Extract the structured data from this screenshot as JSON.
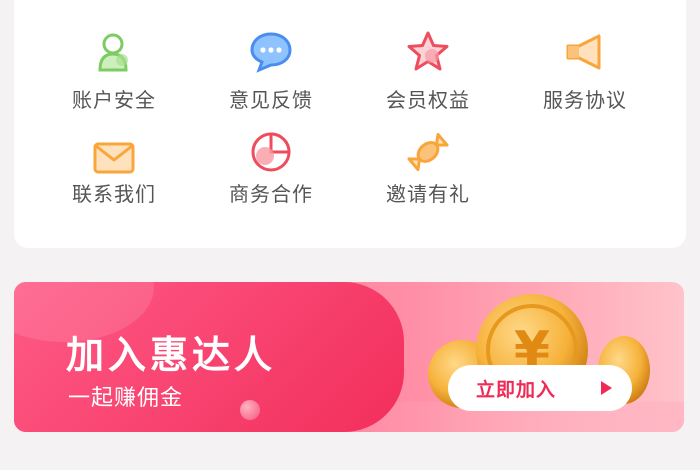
{
  "grid": {
    "items": [
      {
        "label": "账户安全",
        "icon": "user-icon"
      },
      {
        "label": "意见反馈",
        "icon": "chat-bubble-icon"
      },
      {
        "label": "会员权益",
        "icon": "star-icon"
      },
      {
        "label": "服务协议",
        "icon": "megaphone-icon"
      },
      {
        "label": "联系我们",
        "icon": "envelope-icon"
      },
      {
        "label": "商务合作",
        "icon": "pie-chart-icon"
      },
      {
        "label": "邀请有礼",
        "icon": "candy-icon"
      }
    ]
  },
  "banner": {
    "title": "加入惠达人",
    "subtitle": "一起赚佣金",
    "button_label": "立即加入"
  },
  "colors": {
    "accent": "#ee2a55",
    "icon_green": "#7ccc62",
    "icon_blue": "#4a8df0",
    "icon_red": "#ef4d5e",
    "icon_orange": "#f9a53a"
  }
}
